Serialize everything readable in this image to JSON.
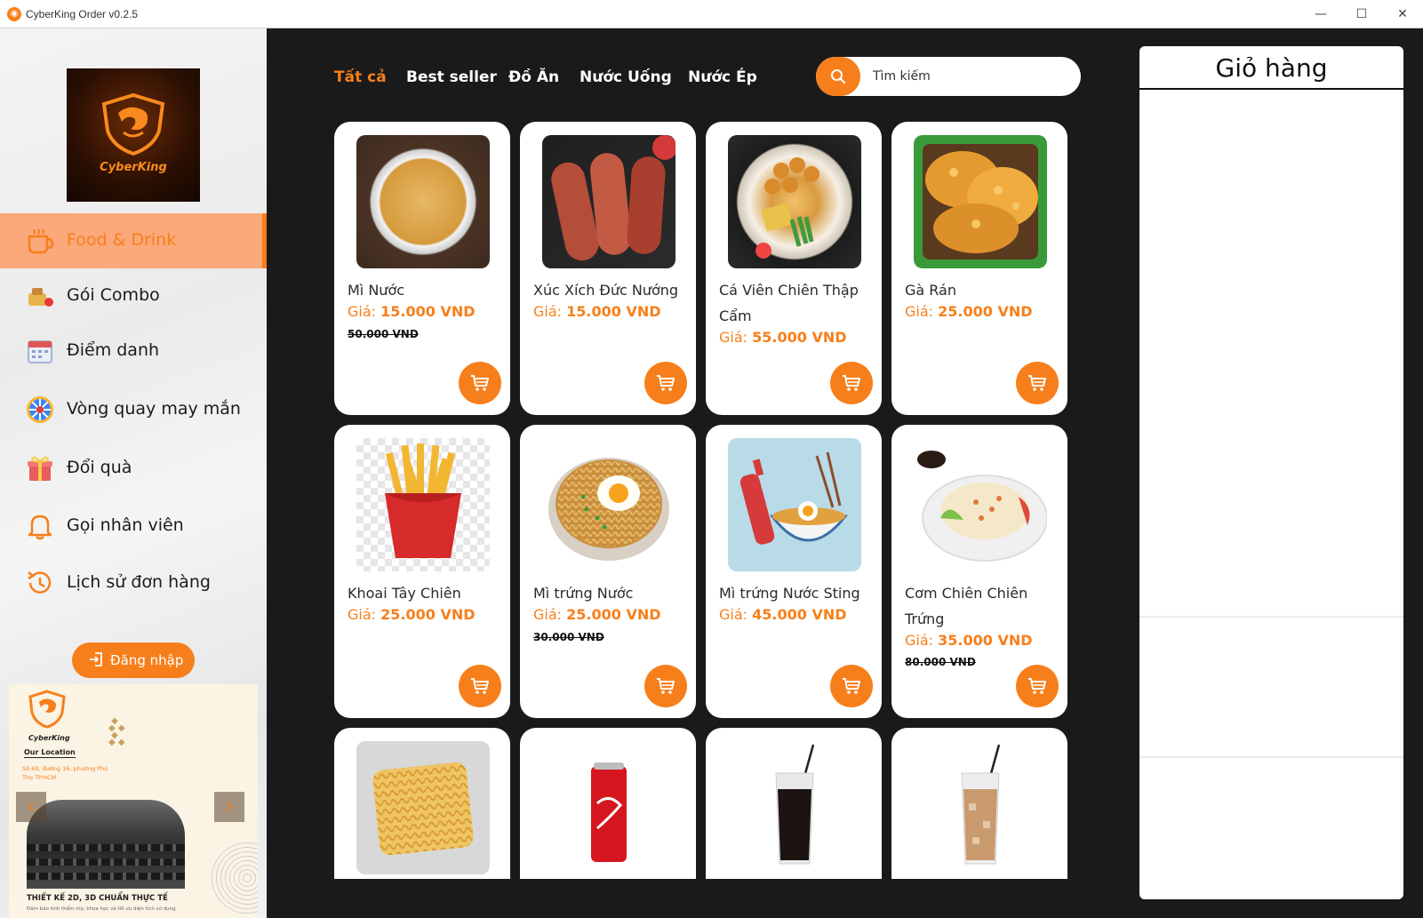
{
  "window": {
    "title": "CyberKing Order v0.2.5",
    "minimize": "—",
    "maximize": "☐",
    "close": "✕"
  },
  "sidebar": {
    "logo_text": "CyberKing",
    "items": [
      {
        "label": "Food & Drink",
        "icon": "cup-icon",
        "active": true
      },
      {
        "label": "Gói Combo",
        "icon": "combo-icon"
      },
      {
        "label": "Điểm danh",
        "icon": "calendar-icon"
      },
      {
        "label": "Vòng quay may mắn",
        "icon": "wheel-icon"
      },
      {
        "label": "Đổi quà",
        "icon": "gift-icon"
      },
      {
        "label": "Gọi nhân viên",
        "icon": "bell-icon"
      },
      {
        "label": "Lịch sử đơn hàng",
        "icon": "history-icon"
      }
    ],
    "login_label": "Đăng nhập",
    "banner": {
      "brand": "CyberKing",
      "location_heading": "Our Location",
      "address": "Số 69, đường 16, phường Phú Thọ TP.HCM",
      "caption": "THIẾT KẾ 2D, 3D CHUẨN THỰC TẾ",
      "sub": "Đảm bảo tính thẩm mỹ, khoa học và tối ưu diện tích sử dụng",
      "prev": "‹",
      "next": "›"
    }
  },
  "categories": [
    "Tất cả",
    "Best seller",
    "Đồ Ăn",
    "Nước Uống",
    "Nước Ép"
  ],
  "search": {
    "placeholder": "Tìm kiếm"
  },
  "products": [
    {
      "name": "Mì Nước",
      "price_label": "Giá: ",
      "price": "15.000 VND",
      "old_price": "50.000 VND"
    },
    {
      "name": "Xúc Xích Đức Nướng",
      "price_label": "Giá: ",
      "price": "15.000 VND",
      "old_price": ""
    },
    {
      "name": "Cá Viên Chiên Thập Cẩm",
      "price_label": "Giá: ",
      "price": "55.000 VND",
      "old_price": ""
    },
    {
      "name": "Gà Rán",
      "price_label": "Giá: ",
      "price": "25.000 VND",
      "old_price": ""
    },
    {
      "name": "Khoai Tây Chiên",
      "price_label": "Giá: ",
      "price": "25.000 VND",
      "old_price": ""
    },
    {
      "name": "Mì trứng Nước",
      "price_label": "Giá: ",
      "price": "25.000 VND",
      "old_price": "30.000 VND"
    },
    {
      "name": "Mì trứng Nước Sting",
      "price_label": "Giá: ",
      "price": "45.000 VND",
      "old_price": ""
    },
    {
      "name": "Cơm Chiên Chiên Trứng",
      "price_label": "Giá: ",
      "price": "35.000 VND",
      "old_price": "80.000 VND"
    }
  ],
  "cart": {
    "title": "Giỏ hàng"
  }
}
